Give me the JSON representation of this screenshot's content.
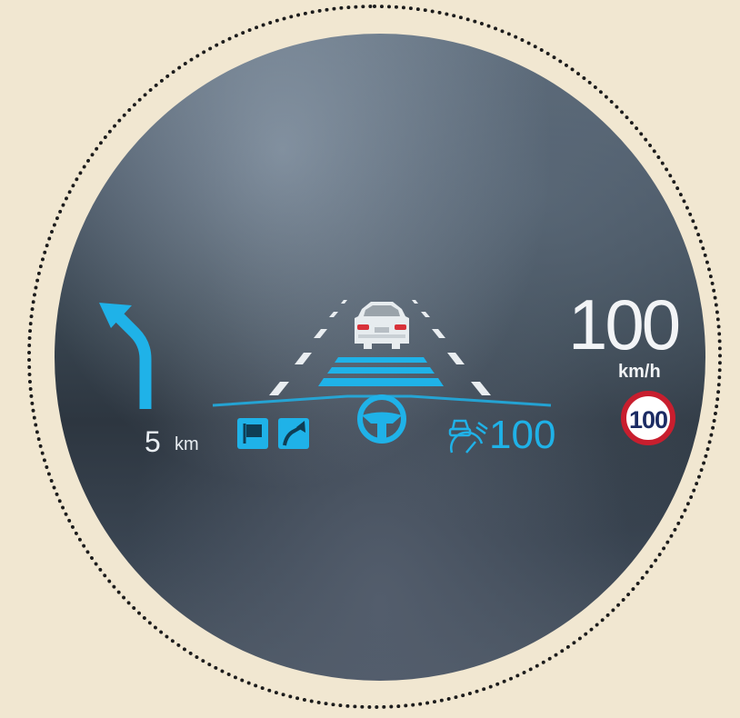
{
  "navigation": {
    "turn_icon": "turn-left-arrow-icon",
    "distance_value": "5",
    "distance_unit": "km",
    "route_icons": [
      "flag-icon",
      "route-turn-icon"
    ]
  },
  "speed": {
    "value": "100",
    "unit": "km/h"
  },
  "cruise_control": {
    "icon": "adaptive-cruise-gauge-icon",
    "set_speed": "100"
  },
  "speed_limit": {
    "value": "100"
  },
  "assist": {
    "lead_vehicle_icon": "car-rear-icon",
    "lane_keeping_icon": "steering-wheel-icon"
  },
  "colors": {
    "hud_blue": "#1fb2e8",
    "text_white": "#f2f4f6",
    "limit_red": "#c81e2e",
    "background": "#f1e7d1"
  }
}
